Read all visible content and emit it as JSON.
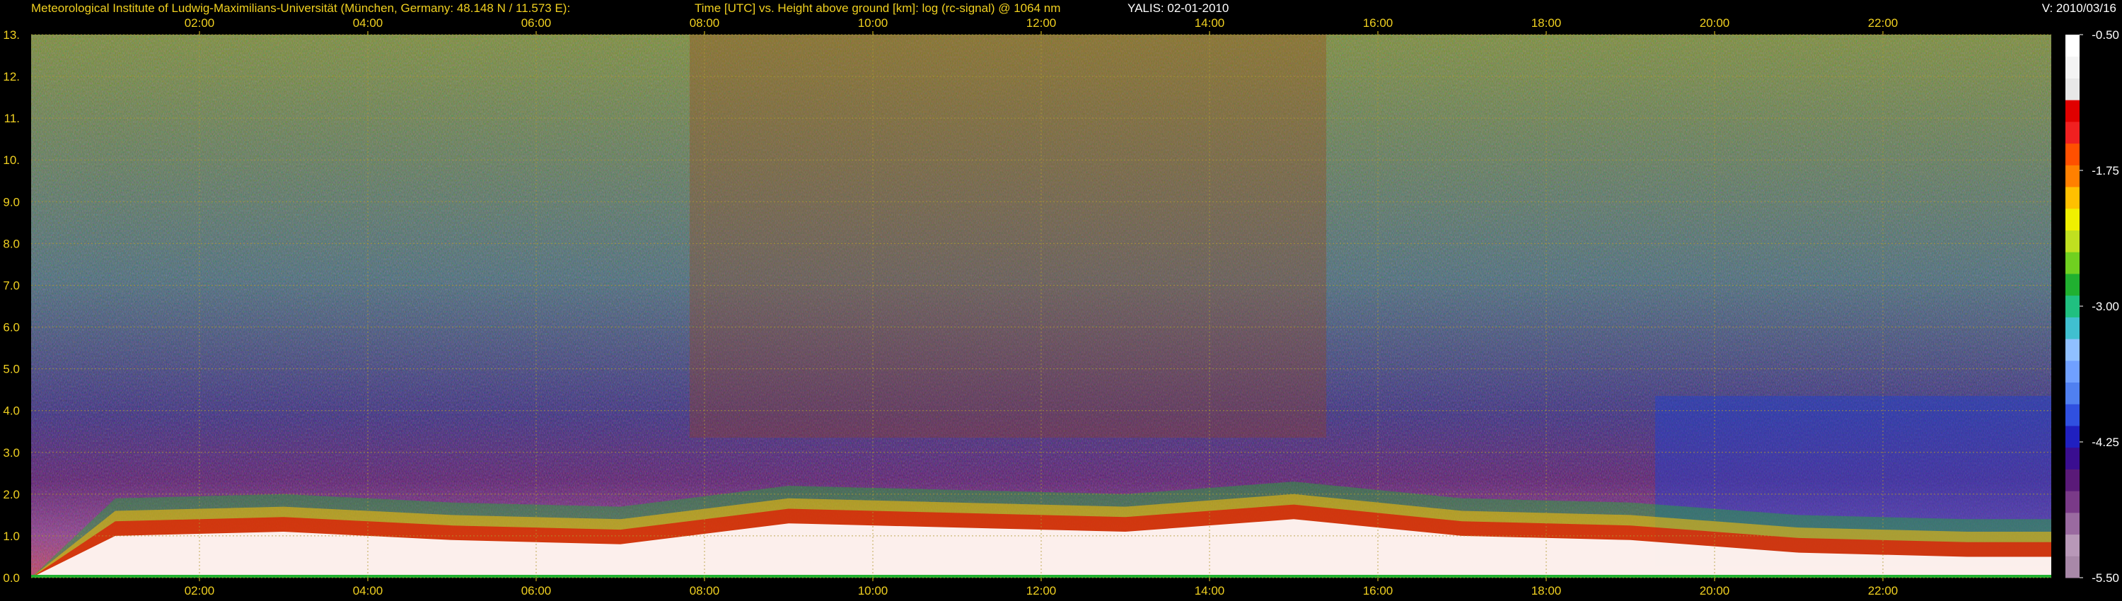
{
  "header": {
    "institute": "Meteorological Institute of Ludwig-Maximilians-Universität (München, Germany: 48.148 N / 11.573 E):",
    "description": "Time [UTC] vs. Height above ground [km]: log (rc-signal) @ 1064 nm",
    "instrument": "YALIS: 02-01-2010",
    "version": "V: 2010/03/16"
  },
  "colors": {
    "background": "#000000",
    "axis_label": "#f0d020",
    "grid": "#b09a30",
    "version_text": "#ffffff"
  },
  "chart_data": {
    "type": "heatmap",
    "x_ticks": [
      "02:00",
      "04:00",
      "06:00",
      "08:00",
      "10:00",
      "12:00",
      "14:00",
      "16:00",
      "18:00",
      "20:00",
      "22:00"
    ],
    "x_range": [
      "00:00",
      "24:00"
    ],
    "y_ticks": [
      "0.0",
      "1.0",
      "2.0",
      "3.0",
      "4.0",
      "5.0",
      "6.0",
      "7.0",
      "8.0",
      "9.0",
      "10.",
      "11.",
      "12.",
      "13."
    ],
    "y_range": [
      0,
      13
    ],
    "grid": true,
    "colorbar": {
      "ticks": [
        "-0.50",
        "-1.75",
        "-3.00",
        "-4.25",
        "-5.50"
      ],
      "range": [
        -5.5,
        -0.5
      ],
      "palette": [
        "#a888a8",
        "#b898b8",
        "#9a6aa0",
        "#7a3a88",
        "#5a1a78",
        "#3a0e90",
        "#2020c0",
        "#3050e0",
        "#5080f0",
        "#70a0ff",
        "#90c0ff",
        "#40c0d0",
        "#20c080",
        "#20b030",
        "#70d020",
        "#c0e020",
        "#f0f000",
        "#ffc000",
        "#ff8000",
        "#ff5000",
        "#f02020",
        "#e00000",
        "#e8e8e8",
        "#f4f4f4",
        "#ffffff"
      ]
    },
    "cloud_base_km": [
      {
        "time": "01:00",
        "height": 1.0
      },
      {
        "time": "03:00",
        "height": 1.1
      },
      {
        "time": "05:00",
        "height": 0.9
      },
      {
        "time": "07:00",
        "height": 0.8
      },
      {
        "time": "09:00",
        "height": 1.3
      },
      {
        "time": "11:00",
        "height": 1.2
      },
      {
        "time": "13:00",
        "height": 1.1
      },
      {
        "time": "15:00",
        "height": 1.4
      },
      {
        "time": "17:00",
        "height": 1.0
      },
      {
        "time": "19:00",
        "height": 0.9
      },
      {
        "time": "21:00",
        "height": 0.6
      },
      {
        "time": "23:00",
        "height": 0.5
      }
    ]
  }
}
